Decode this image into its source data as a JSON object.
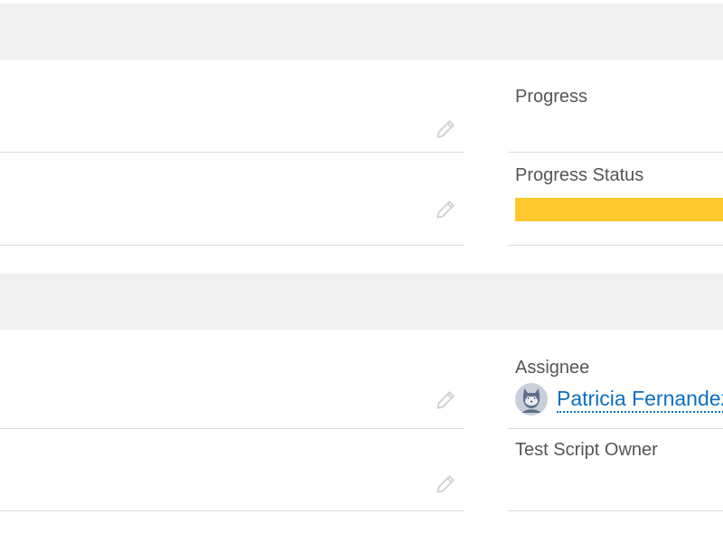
{
  "section_one": {
    "header_text": "",
    "fields_right": [
      {
        "label": "Progress",
        "value": ""
      },
      {
        "label": "Progress Status",
        "progress": {
          "fill_percent": 100,
          "color": "#ffc82c"
        }
      }
    ]
  },
  "section_two": {
    "header_text": "",
    "fields_right": [
      {
        "label": "Assignee",
        "value": "Patricia Fernandez",
        "icon": "user-avatar-icon"
      },
      {
        "label": "Test Script Owner",
        "value": ""
      }
    ]
  },
  "icons": {
    "edit": "pencil-icon"
  },
  "colors": {
    "section_header_bg": "#f0f0f0",
    "link": "#0b6fc1",
    "progress_fill": "#ffc82c",
    "divider": "#dcdcdc"
  }
}
